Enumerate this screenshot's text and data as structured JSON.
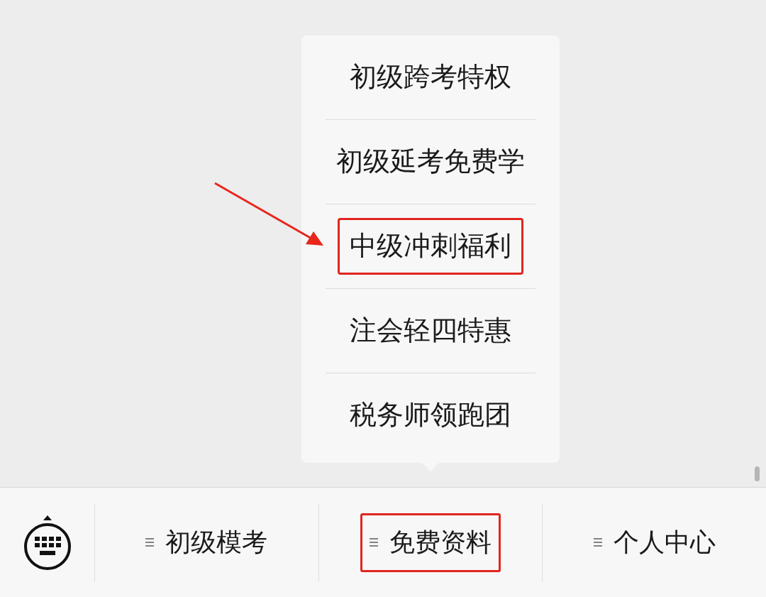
{
  "submenu": {
    "items": [
      {
        "label": "初级跨考特权",
        "highlighted": false
      },
      {
        "label": "初级延考免费学",
        "highlighted": false
      },
      {
        "label": "中级冲刺福利",
        "highlighted": true
      },
      {
        "label": "注会轻四特惠",
        "highlighted": false
      },
      {
        "label": "税务师领跑团",
        "highlighted": false
      }
    ]
  },
  "menu_bar": {
    "tabs": [
      {
        "label": "初级模考",
        "highlighted": false
      },
      {
        "label": "免费资料",
        "highlighted": true
      },
      {
        "label": "个人中心",
        "highlighted": false
      }
    ]
  }
}
